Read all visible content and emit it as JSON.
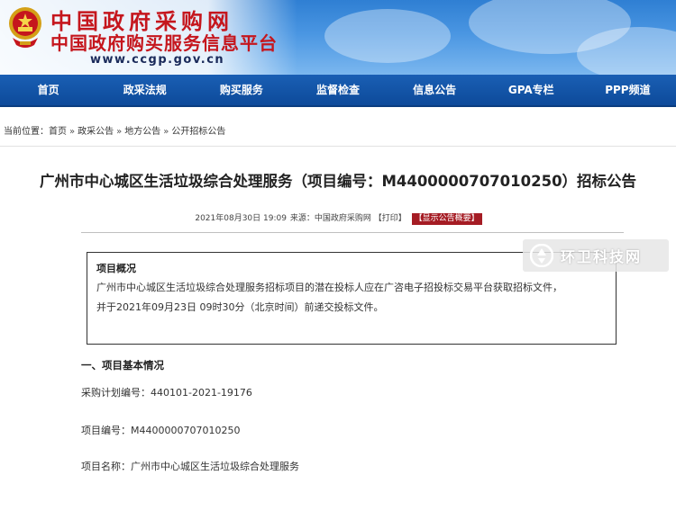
{
  "header": {
    "site_name_1": "中国政府采购网",
    "site_name_2": "中国政府购买服务信息平台",
    "url": "www.ccgp.gov.cn"
  },
  "nav": {
    "items": [
      "首页",
      "政采法规",
      "购买服务",
      "监督检查",
      "信息公告",
      "GPA专栏",
      "PPP频道"
    ]
  },
  "breadcrumb": {
    "prefix": "当前位置：",
    "items": [
      "首页",
      "政采公告",
      "地方公告",
      "公开招标公告"
    ],
    "separator": "»"
  },
  "article": {
    "title": "广州市中心城区生活垃圾综合处理服务（项目编号：M4400000707010250）招标公告",
    "meta": {
      "date": "2021年08月30日 19:09",
      "source_label": "来源：",
      "source": "中国政府采购网",
      "print": "【打印】",
      "show_summary": "【显示公告概要】"
    },
    "summary": {
      "title": "项目概况",
      "line1": "广州市中心城区生活垃圾综合处理服务招标项目的潜在投标人应在广咨电子招投标交易平台获取招标文件，",
      "line2": "并于2021年09月23日 09时30分（北京时间）前递交投标文件。"
    },
    "section1": {
      "heading": "一、项目基本情况",
      "plan_no": "采购计划编号：440101-2021-19176",
      "project_no": "项目编号：M4400000707010250",
      "project_name": "项目名称：广州市中心城区生活垃圾综合处理服务"
    }
  },
  "watermark": {
    "text": "环卫科技网"
  },
  "colors": {
    "nav_bg": "#0d4a9a",
    "brand_red": "#c5161d",
    "badge_red": "#a51c24"
  }
}
